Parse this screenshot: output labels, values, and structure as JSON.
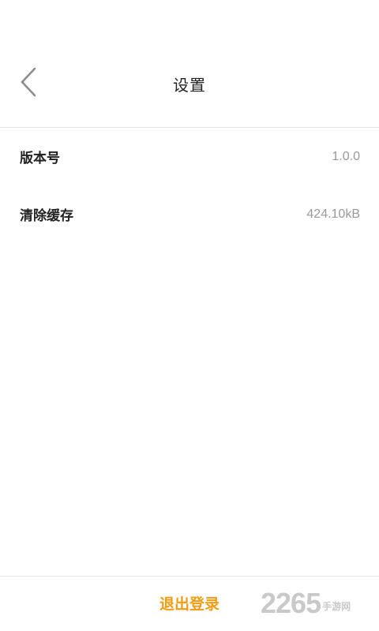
{
  "header": {
    "title": "设置",
    "back_icon": "chevron-left-icon"
  },
  "settings": {
    "items": [
      {
        "label": "版本号",
        "value": "1.0.0"
      },
      {
        "label": "清除缓存",
        "value": "424.10kB"
      }
    ]
  },
  "footer": {
    "logout_label": "退出登录"
  },
  "watermark": {
    "number": "2265",
    "text": "手游网"
  },
  "colors": {
    "accent": "#f39c12",
    "text_primary": "#222222",
    "text_secondary": "#999999",
    "divider": "#e6e6e6"
  }
}
